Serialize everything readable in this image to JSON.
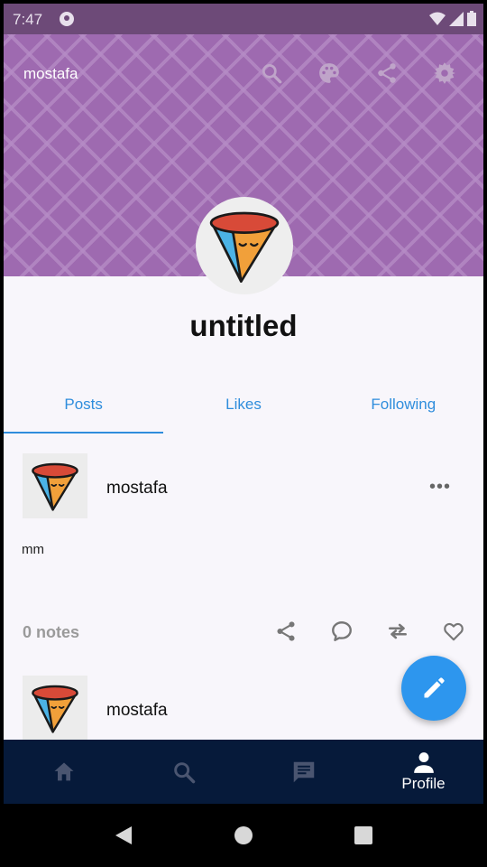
{
  "status_bar": {
    "time": "7:47"
  },
  "header": {
    "username": "mostafa",
    "icons": [
      "search-icon",
      "palette-icon",
      "share-icon",
      "settings-icon"
    ]
  },
  "profile": {
    "title": "untitled"
  },
  "tabs": [
    {
      "label": "Posts",
      "active": true
    },
    {
      "label": "Likes",
      "active": false
    },
    {
      "label": "Following",
      "active": false
    }
  ],
  "posts": [
    {
      "username": "mostafa",
      "more": "•••",
      "body": "mm",
      "notes": "0 notes"
    },
    {
      "username": "mostafa"
    }
  ],
  "bottom_nav": {
    "items": [
      {
        "icon": "home-icon",
        "label": ""
      },
      {
        "icon": "search-icon",
        "label": ""
      },
      {
        "icon": "chat-icon",
        "label": ""
      },
      {
        "icon": "person-icon",
        "label": "Profile",
        "active": true
      }
    ]
  },
  "colors": {
    "header_purple": "#9e6ab0",
    "accent_blue": "#2f8ddc",
    "fab_blue": "#2d96ee",
    "nav_navy": "#061a3a"
  }
}
